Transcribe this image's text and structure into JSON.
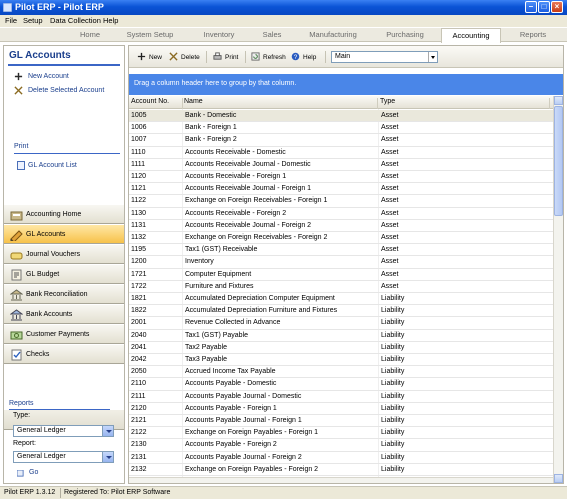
{
  "window": {
    "title": "Pilot ERP - Pilot ERP"
  },
  "menu": [
    "File",
    "Setup",
    "Data Collection",
    "Help"
  ],
  "module_tabs": [
    "Home",
    "System Setup",
    "Inventory",
    "Sales",
    "Manufacturing",
    "Purchasing",
    "Accounting",
    "Reports"
  ],
  "active_tab": "Accounting",
  "left": {
    "title": "GL Accounts",
    "actions": [
      "New Account",
      "Delete Selected Account"
    ],
    "print_heading": "Print",
    "print_link": "GL Account List",
    "nav": [
      "Accounting Home",
      "GL Accounts",
      "Journal Vouchers",
      "GL Budget",
      "Bank Reconciliation",
      "Bank Accounts",
      "Customer Payments",
      "Checks"
    ],
    "active_nav": "GL Accounts",
    "reports": {
      "heading": "Reports",
      "type_label": "Type:",
      "type_value": "General Ledger",
      "report_label": "Report:",
      "report_value": "General Ledger",
      "go_label": "Go"
    }
  },
  "toolbar": {
    "new": "New",
    "delete": "Delete",
    "print": "Print",
    "refresh": "Refresh",
    "help": "Help",
    "view_value": "Main"
  },
  "group_hint": "Drag a column header here to group by that column.",
  "columns": [
    "Account No.",
    "Name",
    "Type"
  ],
  "rows": [
    [
      "1005",
      "Bank - Domestic",
      "Asset"
    ],
    [
      "1006",
      "Bank - Foreign 1",
      "Asset"
    ],
    [
      "1007",
      "Bank - Foreign 2",
      "Asset"
    ],
    [
      "1110",
      "Accounts Receivable - Domestic",
      "Asset"
    ],
    [
      "1111",
      "Accounts Receivable Journal - Domestic",
      "Asset"
    ],
    [
      "1120",
      "Accounts Receivable - Foreign 1",
      "Asset"
    ],
    [
      "1121",
      "Accounts Receivable Journal - Foreign 1",
      "Asset"
    ],
    [
      "1122",
      "Exchange on Foreign Receivables - Foreign 1",
      "Asset"
    ],
    [
      "1130",
      "Accounts Receivable - Foreign 2",
      "Asset"
    ],
    [
      "1131",
      "Accounts Receivable Journal - Foreign 2",
      "Asset"
    ],
    [
      "1132",
      "Exchange on Foreign Receivables - Foreign 2",
      "Asset"
    ],
    [
      "1195",
      "Tax1 (GST) Receivable",
      "Asset"
    ],
    [
      "1200",
      "Inventory",
      "Asset"
    ],
    [
      "1721",
      "Computer Equipment",
      "Asset"
    ],
    [
      "1722",
      "Furniture and Fixtures",
      "Asset"
    ],
    [
      "1821",
      "Accumulated Depreciation Computer Equipment",
      "Liability"
    ],
    [
      "1822",
      "Accumulated Depreciation Furniture and Fixtures",
      "Liability"
    ],
    [
      "2001",
      "Revenue Collected in Advance",
      "Liability"
    ],
    [
      "2040",
      "Tax1 (GST) Payable",
      "Liability"
    ],
    [
      "2041",
      "Tax2 Payable",
      "Liability"
    ],
    [
      "2042",
      "Tax3 Payable",
      "Liability"
    ],
    [
      "2050",
      "Accrued Income Tax Payable",
      "Liability"
    ],
    [
      "2110",
      "Accounts Payable - Domestic",
      "Liability"
    ],
    [
      "2111",
      "Accounts Payable Journal - Domestic",
      "Liability"
    ],
    [
      "2120",
      "Accounts Payable - Foreign 1",
      "Liability"
    ],
    [
      "2121",
      "Accounts Payable Journal - Foreign 1",
      "Liability"
    ],
    [
      "2122",
      "Exchange on Foreign Payables - Foreign 1",
      "Liability"
    ],
    [
      "2130",
      "Accounts Payable - Foreign 2",
      "Liability"
    ],
    [
      "2131",
      "Accounts Payable Journal - Foreign 2",
      "Liability"
    ],
    [
      "2132",
      "Exchange on Foreign Payables - Foreign 2",
      "Liability"
    ]
  ],
  "selected_row": 0,
  "status": {
    "version": "Pilot ERP 1.3.12",
    "registered": "Registered To: Pilot ERP Software"
  },
  "colors": {
    "accent": "#4a86e8",
    "active_nav": "#f7c24a",
    "title_bar": "#0a53d6"
  }
}
